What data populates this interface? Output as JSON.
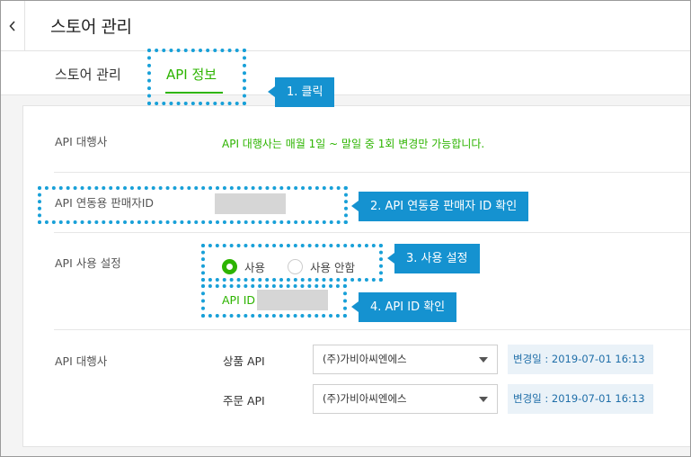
{
  "header": {
    "title": "스토어 관리",
    "back_icon": "chevron-left-icon"
  },
  "tabs": [
    {
      "label": "스토어 관리",
      "active": false
    },
    {
      "label": "API 정보",
      "active": true
    }
  ],
  "accent_color": "#2db400",
  "callout_color": "#1592d0",
  "rows": {
    "agency_notice": {
      "label": "API 대행사",
      "notice": "API 대행사는 매월 1일 ~ 말일 중 1회 변경만 가능합니다."
    },
    "seller_id": {
      "label": "API 연동용 판매자ID"
    },
    "usage": {
      "label": "API 사용 설정",
      "options": [
        {
          "label": "사용",
          "selected": true
        },
        {
          "label": "사용 안함",
          "selected": false
        }
      ],
      "api_id_label": "API ID"
    },
    "agency": {
      "label": "API 대행사",
      "product": {
        "label": "상품 API",
        "selected": "(주)가비아씨엔에스",
        "changed": "변경일 : 2019-07-01 16:13"
      },
      "order": {
        "label": "주문 API",
        "selected": "(주)가비아씨엔에스",
        "changed": "변경일 : 2019-07-01 16:13"
      }
    }
  },
  "annotations": [
    "1. 클릭",
    "2. API 연동용 판매자 ID 확인",
    "3. 사용 설정",
    "4. API ID 확인"
  ]
}
